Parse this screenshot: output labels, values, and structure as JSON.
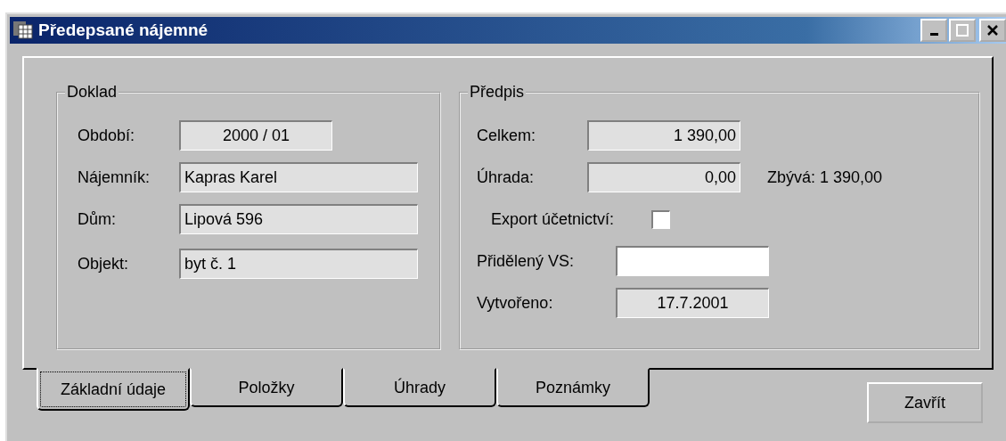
{
  "window": {
    "title": "Předepsané nájemné"
  },
  "groups": [
    {
      "title": "Doklad",
      "rows": [
        {
          "kind": "field",
          "label": "Období:",
          "value": "2000 / 01",
          "editable": false
        },
        {
          "kind": "field",
          "label": "Nájemník:",
          "value": "Kapras Karel",
          "editable": false
        },
        {
          "kind": "field",
          "label": "Dům:",
          "value": "Lipová 596",
          "editable": false
        },
        {
          "kind": "field",
          "label": "Objekt:",
          "value": "byt č. 1",
          "editable": false
        }
      ]
    },
    {
      "title": "Předpis",
      "rows": [
        {
          "kind": "field",
          "label": "Celkem:",
          "value": "1 390,00",
          "editable": false
        },
        {
          "kind": "field",
          "label": "Úhrada:",
          "value": "0,00",
          "editable": false,
          "note": "Zbývá: 1 390,00"
        },
        {
          "kind": "checkbox",
          "label": "Export účetnictví:",
          "checked": false
        },
        {
          "kind": "field",
          "label": "Přidělený VS:",
          "value": "",
          "editable": true
        },
        {
          "kind": "field",
          "label": "Vytvořeno:",
          "value": "17.7.2001",
          "editable": false
        }
      ]
    }
  ],
  "tabs": [
    {
      "label": "Základní údaje",
      "selected": true
    },
    {
      "label": "Položky",
      "selected": false
    },
    {
      "label": "Úhrady",
      "selected": false
    },
    {
      "label": "Poznámky",
      "selected": false
    }
  ],
  "buttons": [
    "Zavřít"
  ]
}
